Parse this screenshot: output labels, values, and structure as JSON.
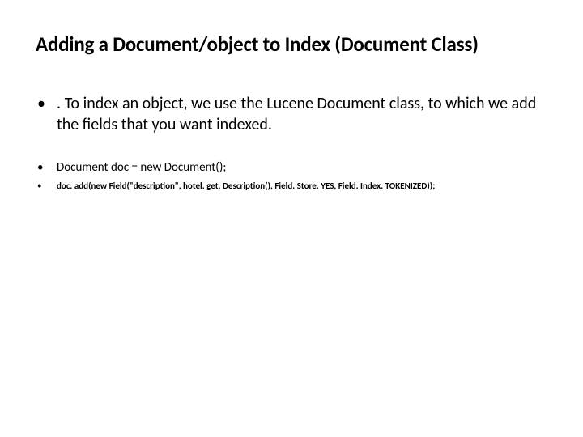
{
  "title": "Adding a Document/object to Index (Document  Class)",
  "bullets": {
    "b1": ". To index an object, we use the Lucene Document class, to which we add the fields that you want indexed.",
    "b2": "Document doc = new Document();",
    "b3": "doc. add(new Field(\"description\", hotel. get. Description(), Field. Store. YES, Field. Index. TOKENIZED));"
  }
}
